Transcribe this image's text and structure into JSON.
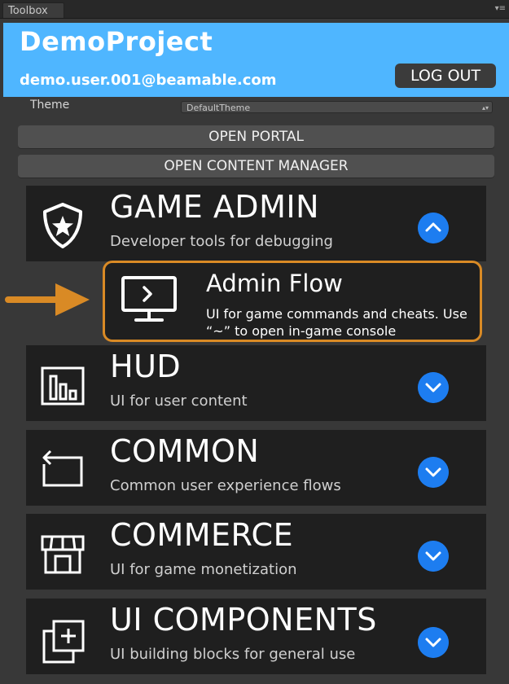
{
  "window": {
    "tab_title": "Toolbox",
    "menu_glyph": "▾≡"
  },
  "header": {
    "project_name": "DemoProject",
    "user_email": "demo.user.001@beamable.com",
    "logout_label": "LOG OUT",
    "background_color": "#4fb6ff"
  },
  "theme": {
    "label": "Theme",
    "selected": "DefaultTheme",
    "arrow": "▴▾"
  },
  "actions": {
    "open_portal": "OPEN PORTAL",
    "open_content_manager": "OPEN CONTENT MANAGER"
  },
  "categories": [
    {
      "title": "GAME ADMIN",
      "description": "Developer tools for debugging",
      "icon": "shield-star-icon",
      "expanded": true
    },
    {
      "title": "HUD",
      "description": "UI for user content",
      "icon": "bar-chart-icon",
      "expanded": false
    },
    {
      "title": "COMMON",
      "description": "Common user experience flows",
      "icon": "back-arrow-frame-icon",
      "expanded": false
    },
    {
      "title": "COMMERCE",
      "description": "UI for game monetization",
      "icon": "storefront-icon",
      "expanded": false
    },
    {
      "title": "UI COMPONENTS",
      "description": "UI building blocks for general use",
      "icon": "add-layers-icon",
      "expanded": false
    }
  ],
  "admin_flow": {
    "title": "Admin Flow",
    "description": "UI for game commands and cheats. Use “~” to open in-game console",
    "icon": "monitor-console-icon",
    "highlight_color": "#d98a25"
  },
  "accent_color": "#1d7df0"
}
